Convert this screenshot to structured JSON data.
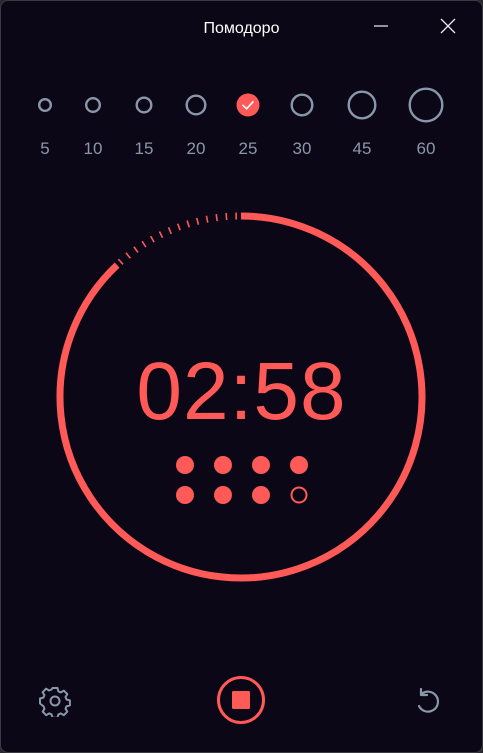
{
  "window": {
    "title": "Помодоро"
  },
  "presets": [
    {
      "label": "5",
      "selected": false
    },
    {
      "label": "10",
      "selected": false
    },
    {
      "label": "15",
      "selected": false
    },
    {
      "label": "20",
      "selected": false
    },
    {
      "label": "25",
      "selected": true
    },
    {
      "label": "30",
      "selected": false
    },
    {
      "label": "45",
      "selected": false
    },
    {
      "label": "60",
      "selected": false
    }
  ],
  "timer": {
    "display": "02:58",
    "progress_fraction": 0.88,
    "sessions_completed": 7,
    "sessions_total": 8
  },
  "colors": {
    "background": "#0b0716",
    "accent": "#ff5a57",
    "muted": "#8a97ab",
    "title_text": "#ffffff"
  },
  "icons": {
    "minimize": "minimize-icon",
    "close": "close-icon",
    "settings": "gear-icon",
    "stop": "stop-icon",
    "reset": "reset-icon",
    "check": "check-icon"
  }
}
